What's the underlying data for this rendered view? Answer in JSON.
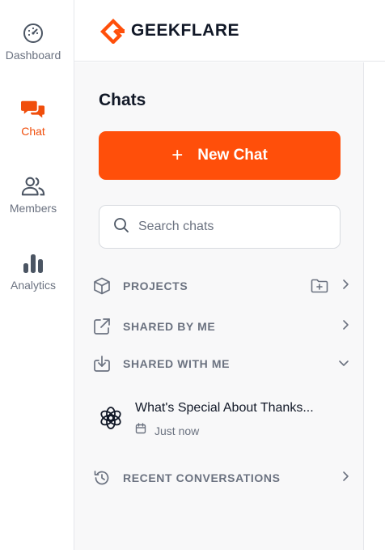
{
  "brand": {
    "name": "GEEKFLARE",
    "accent": "#ff4f0a"
  },
  "nav": {
    "items": [
      {
        "label": "Dashboard",
        "icon": "gauge-icon",
        "active": false
      },
      {
        "label": "Chat",
        "icon": "chat-bubbles-icon",
        "active": true
      },
      {
        "label": "Members",
        "icon": "users-icon",
        "active": false
      },
      {
        "label": "Analytics",
        "icon": "bar-chart-icon",
        "active": false
      }
    ]
  },
  "panel": {
    "title": "Chats",
    "new_chat": {
      "plus": "+",
      "label": "New Chat"
    },
    "search": {
      "placeholder": "Search chats"
    },
    "sections": {
      "projects": "PROJECTS",
      "shared_by_me": "SHARED BY ME",
      "shared_with_me": "SHARED WITH ME",
      "recent": "RECENT CONVERSATIONS"
    },
    "shared_chat": {
      "title": "What's Special About Thanks...",
      "time": "Just now",
      "icon": "openai-icon"
    }
  }
}
